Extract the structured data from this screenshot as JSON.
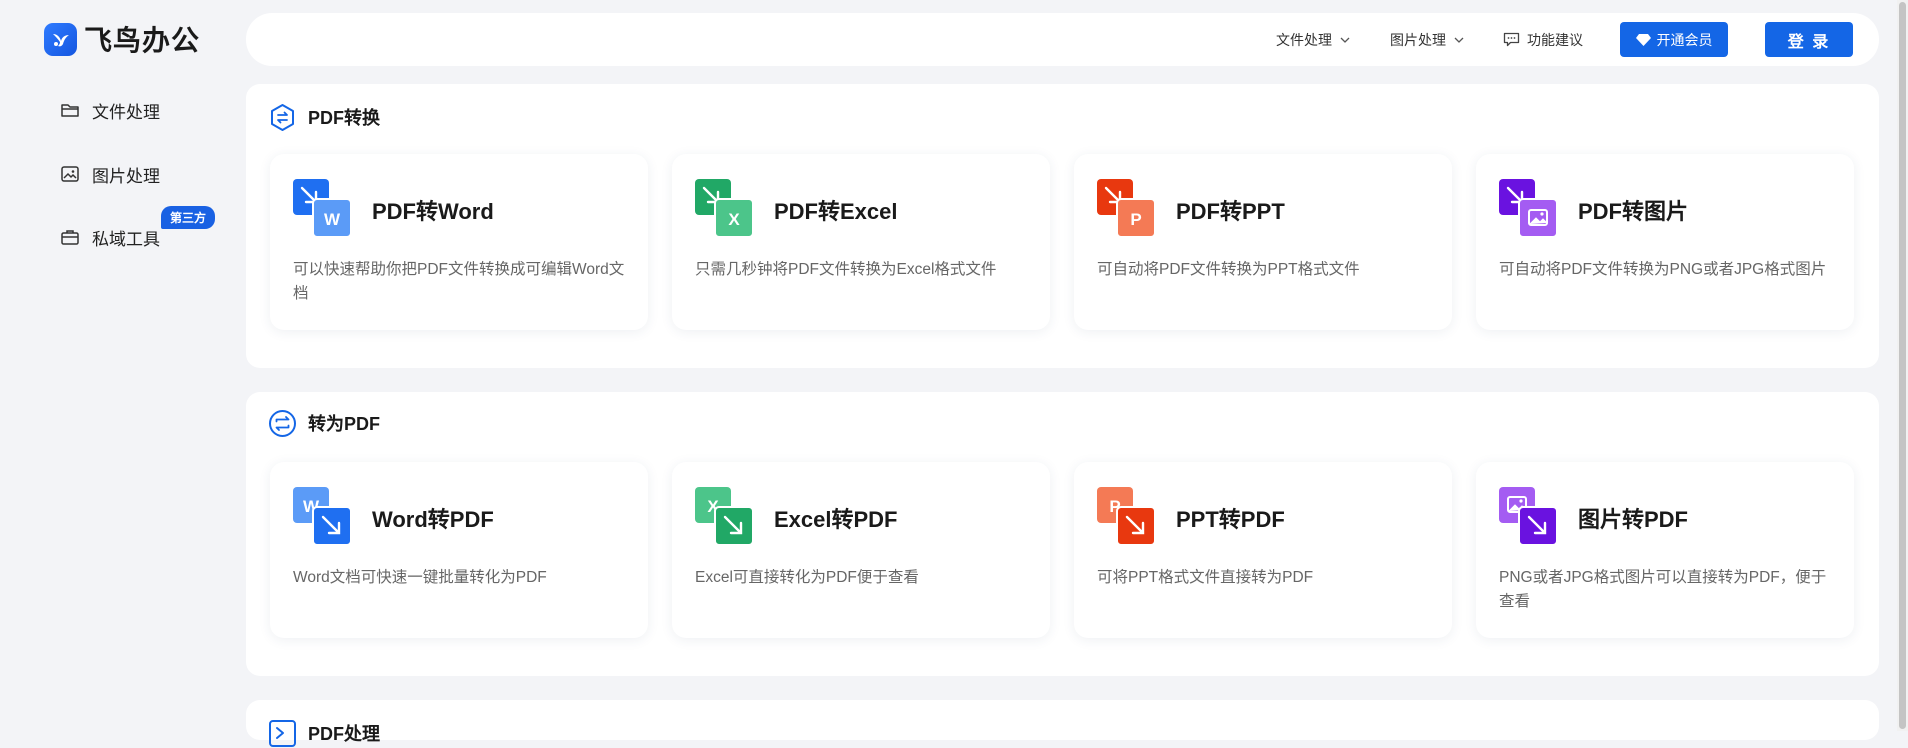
{
  "app": {
    "logo_text": "飞鸟办公"
  },
  "sidebar": {
    "items": [
      {
        "label": "文件处理",
        "icon": "folder-icon"
      },
      {
        "label": "图片处理",
        "icon": "image-icon"
      },
      {
        "label": "私域工具",
        "icon": "toolbox-icon",
        "badge": "第三方"
      }
    ]
  },
  "topbar": {
    "file_menu": "文件处理",
    "image_menu": "图片处理",
    "feedback": "功能建议",
    "vip_button": "开通会员",
    "login_button": "登 录"
  },
  "sections": [
    {
      "title": "PDF转换",
      "cards": [
        {
          "title": "PDF转Word",
          "desc": "可以快速帮助你把PDF文件转换成可编辑Word文档",
          "letter": "W",
          "color": "#1f6ff1"
        },
        {
          "title": "PDF转Excel",
          "desc": "只需几秒钟将PDF文件转换为Excel格式文件",
          "letter": "X",
          "color": "#21a866"
        },
        {
          "title": "PDF转PPT",
          "desc": "可自动将PDF文件转换为PPT格式文件",
          "letter": "P",
          "color": "#ee4a1f"
        },
        {
          "title": "PDF转图片",
          "desc": "可自动将PDF文件转换为PNG或者JPG格式图片",
          "letter": "",
          "color": "#7a22e8"
        }
      ]
    },
    {
      "title": "转为PDF",
      "cards": [
        {
          "title": "Word转PDF",
          "desc": "Word文档可快速一键批量转化为PDF",
          "letter": "W",
          "color": "#1f6ff1"
        },
        {
          "title": "Excel转PDF",
          "desc": "Excel可直接转化为PDF便于查看",
          "letter": "X",
          "color": "#21a866"
        },
        {
          "title": "PPT转PDF",
          "desc": "可将PPT格式文件直接转为PDF",
          "letter": "P",
          "color": "#ee4a1f"
        },
        {
          "title": "图片转PDF",
          "desc": "PNG或者JPG格式图片可以直接转为PDF，便于查看",
          "letter": "",
          "color": "#7a22e8"
        }
      ]
    },
    {
      "title": "PDF处理"
    }
  ],
  "colors": {
    "accent": "#1466e6",
    "background": "#f3f4f7",
    "word": "#1f6ff1",
    "excel": "#21a866",
    "ppt": "#ee4a1f",
    "image": "#7a22e8"
  }
}
